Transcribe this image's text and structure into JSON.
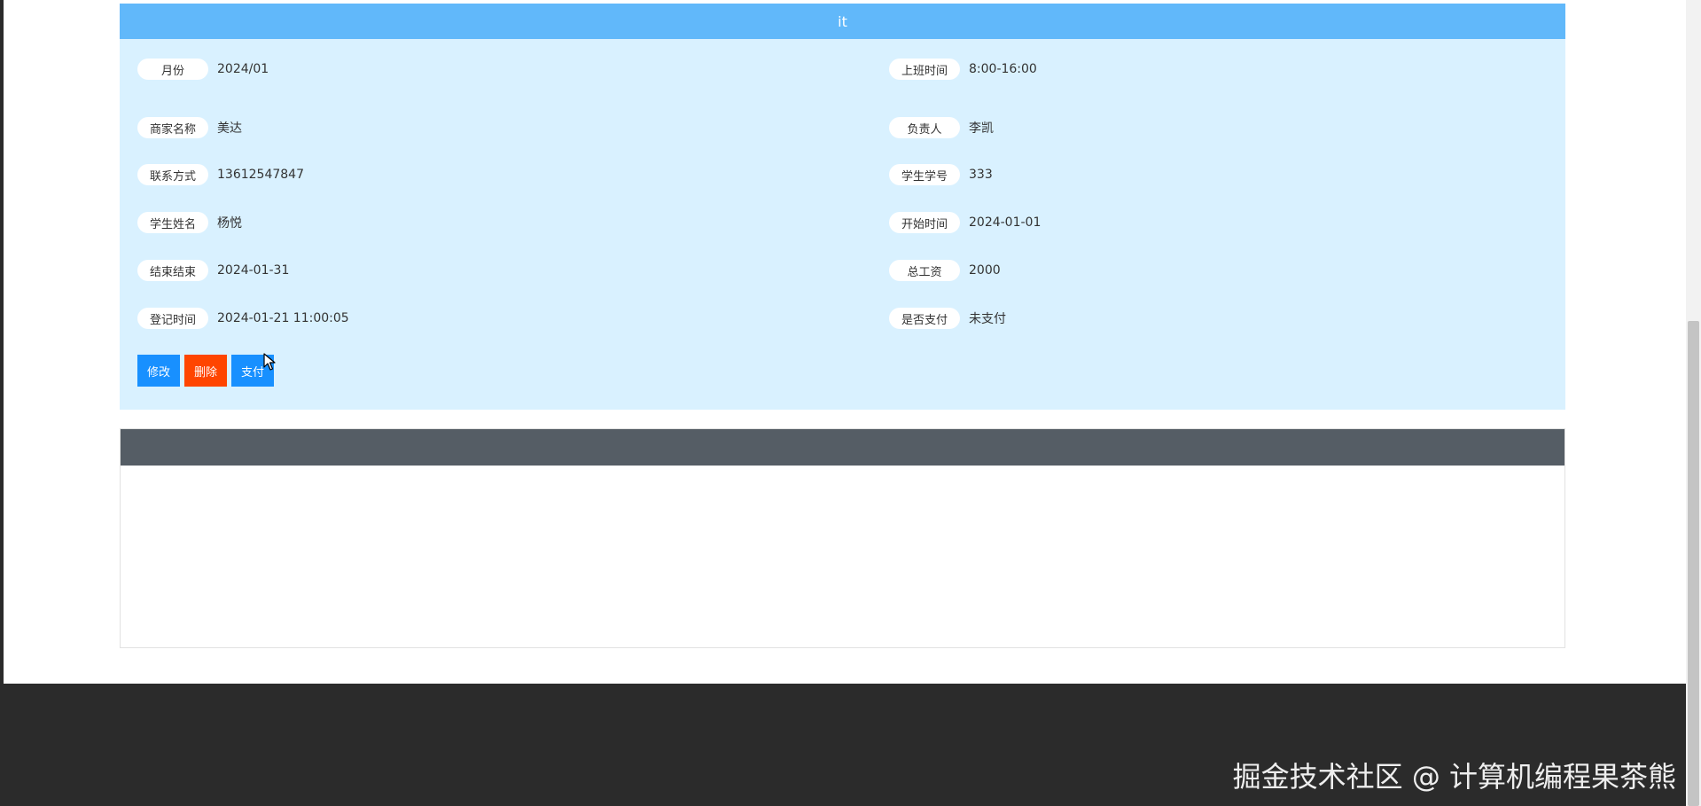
{
  "detail": {
    "header_title": "it",
    "fields": [
      {
        "label": "月份",
        "value": "2024/01"
      },
      {
        "label": "上班时间",
        "value": "8:00-16:00"
      },
      {
        "label": "商家名称",
        "value": "美达"
      },
      {
        "label": "负责人",
        "value": "李凯"
      },
      {
        "label": "联系方式",
        "value": "13612547847"
      },
      {
        "label": "学生学号",
        "value": "333"
      },
      {
        "label": "学生姓名",
        "value": "杨悦"
      },
      {
        "label": "开始时间",
        "value": "2024-01-01"
      },
      {
        "label": "结束结束",
        "value": "2024-01-31"
      },
      {
        "label": "总工资",
        "value": "2000"
      },
      {
        "label": "登记时间",
        "value": "2024-01-21 11:00:05"
      },
      {
        "label": "是否支付",
        "value": "未支付"
      }
    ],
    "buttons": {
      "edit": "修改",
      "delete": "删除",
      "pay": "支付"
    }
  },
  "footer": {
    "watermark": "掘金技术社区 @ 计算机编程果茶熊"
  },
  "colors": {
    "header_bg": "#61b8fa",
    "card_bg": "#d9f1ff",
    "primary": "#1890ff",
    "danger": "#ff4500",
    "comment_header_bg": "#555d65",
    "footer_bg": "#2b2b2b"
  },
  "icons": {
    "cursor": "mouse-cursor-icon"
  }
}
